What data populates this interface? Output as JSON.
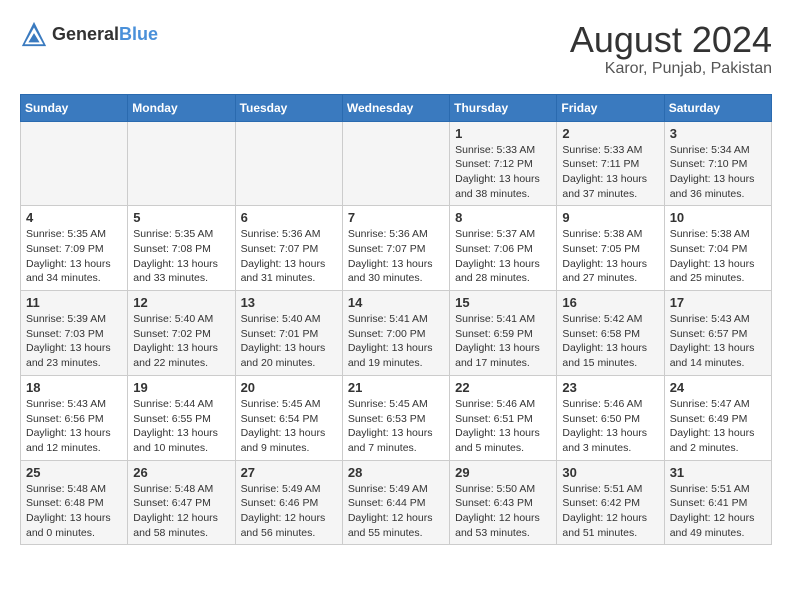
{
  "header": {
    "logo_general": "General",
    "logo_blue": "Blue",
    "title": "August 2024",
    "subtitle": "Karor, Punjab, Pakistan"
  },
  "days_of_week": [
    "Sunday",
    "Monday",
    "Tuesday",
    "Wednesday",
    "Thursday",
    "Friday",
    "Saturday"
  ],
  "weeks": [
    [
      {
        "day": "",
        "content": ""
      },
      {
        "day": "",
        "content": ""
      },
      {
        "day": "",
        "content": ""
      },
      {
        "day": "",
        "content": ""
      },
      {
        "day": "1",
        "content": "Sunrise: 5:33 AM\nSunset: 7:12 PM\nDaylight: 13 hours\nand 38 minutes."
      },
      {
        "day": "2",
        "content": "Sunrise: 5:33 AM\nSunset: 7:11 PM\nDaylight: 13 hours\nand 37 minutes."
      },
      {
        "day": "3",
        "content": "Sunrise: 5:34 AM\nSunset: 7:10 PM\nDaylight: 13 hours\nand 36 minutes."
      }
    ],
    [
      {
        "day": "4",
        "content": "Sunrise: 5:35 AM\nSunset: 7:09 PM\nDaylight: 13 hours\nand 34 minutes."
      },
      {
        "day": "5",
        "content": "Sunrise: 5:35 AM\nSunset: 7:08 PM\nDaylight: 13 hours\nand 33 minutes."
      },
      {
        "day": "6",
        "content": "Sunrise: 5:36 AM\nSunset: 7:07 PM\nDaylight: 13 hours\nand 31 minutes."
      },
      {
        "day": "7",
        "content": "Sunrise: 5:36 AM\nSunset: 7:07 PM\nDaylight: 13 hours\nand 30 minutes."
      },
      {
        "day": "8",
        "content": "Sunrise: 5:37 AM\nSunset: 7:06 PM\nDaylight: 13 hours\nand 28 minutes."
      },
      {
        "day": "9",
        "content": "Sunrise: 5:38 AM\nSunset: 7:05 PM\nDaylight: 13 hours\nand 27 minutes."
      },
      {
        "day": "10",
        "content": "Sunrise: 5:38 AM\nSunset: 7:04 PM\nDaylight: 13 hours\nand 25 minutes."
      }
    ],
    [
      {
        "day": "11",
        "content": "Sunrise: 5:39 AM\nSunset: 7:03 PM\nDaylight: 13 hours\nand 23 minutes."
      },
      {
        "day": "12",
        "content": "Sunrise: 5:40 AM\nSunset: 7:02 PM\nDaylight: 13 hours\nand 22 minutes."
      },
      {
        "day": "13",
        "content": "Sunrise: 5:40 AM\nSunset: 7:01 PM\nDaylight: 13 hours\nand 20 minutes."
      },
      {
        "day": "14",
        "content": "Sunrise: 5:41 AM\nSunset: 7:00 PM\nDaylight: 13 hours\nand 19 minutes."
      },
      {
        "day": "15",
        "content": "Sunrise: 5:41 AM\nSunset: 6:59 PM\nDaylight: 13 hours\nand 17 minutes."
      },
      {
        "day": "16",
        "content": "Sunrise: 5:42 AM\nSunset: 6:58 PM\nDaylight: 13 hours\nand 15 minutes."
      },
      {
        "day": "17",
        "content": "Sunrise: 5:43 AM\nSunset: 6:57 PM\nDaylight: 13 hours\nand 14 minutes."
      }
    ],
    [
      {
        "day": "18",
        "content": "Sunrise: 5:43 AM\nSunset: 6:56 PM\nDaylight: 13 hours\nand 12 minutes."
      },
      {
        "day": "19",
        "content": "Sunrise: 5:44 AM\nSunset: 6:55 PM\nDaylight: 13 hours\nand 10 minutes."
      },
      {
        "day": "20",
        "content": "Sunrise: 5:45 AM\nSunset: 6:54 PM\nDaylight: 13 hours\nand 9 minutes."
      },
      {
        "day": "21",
        "content": "Sunrise: 5:45 AM\nSunset: 6:53 PM\nDaylight: 13 hours\nand 7 minutes."
      },
      {
        "day": "22",
        "content": "Sunrise: 5:46 AM\nSunset: 6:51 PM\nDaylight: 13 hours\nand 5 minutes."
      },
      {
        "day": "23",
        "content": "Sunrise: 5:46 AM\nSunset: 6:50 PM\nDaylight: 13 hours\nand 3 minutes."
      },
      {
        "day": "24",
        "content": "Sunrise: 5:47 AM\nSunset: 6:49 PM\nDaylight: 13 hours\nand 2 minutes."
      }
    ],
    [
      {
        "day": "25",
        "content": "Sunrise: 5:48 AM\nSunset: 6:48 PM\nDaylight: 13 hours\nand 0 minutes."
      },
      {
        "day": "26",
        "content": "Sunrise: 5:48 AM\nSunset: 6:47 PM\nDaylight: 12 hours\nand 58 minutes."
      },
      {
        "day": "27",
        "content": "Sunrise: 5:49 AM\nSunset: 6:46 PM\nDaylight: 12 hours\nand 56 minutes."
      },
      {
        "day": "28",
        "content": "Sunrise: 5:49 AM\nSunset: 6:44 PM\nDaylight: 12 hours\nand 55 minutes."
      },
      {
        "day": "29",
        "content": "Sunrise: 5:50 AM\nSunset: 6:43 PM\nDaylight: 12 hours\nand 53 minutes."
      },
      {
        "day": "30",
        "content": "Sunrise: 5:51 AM\nSunset: 6:42 PM\nDaylight: 12 hours\nand 51 minutes."
      },
      {
        "day": "31",
        "content": "Sunrise: 5:51 AM\nSunset: 6:41 PM\nDaylight: 12 hours\nand 49 minutes."
      }
    ]
  ]
}
